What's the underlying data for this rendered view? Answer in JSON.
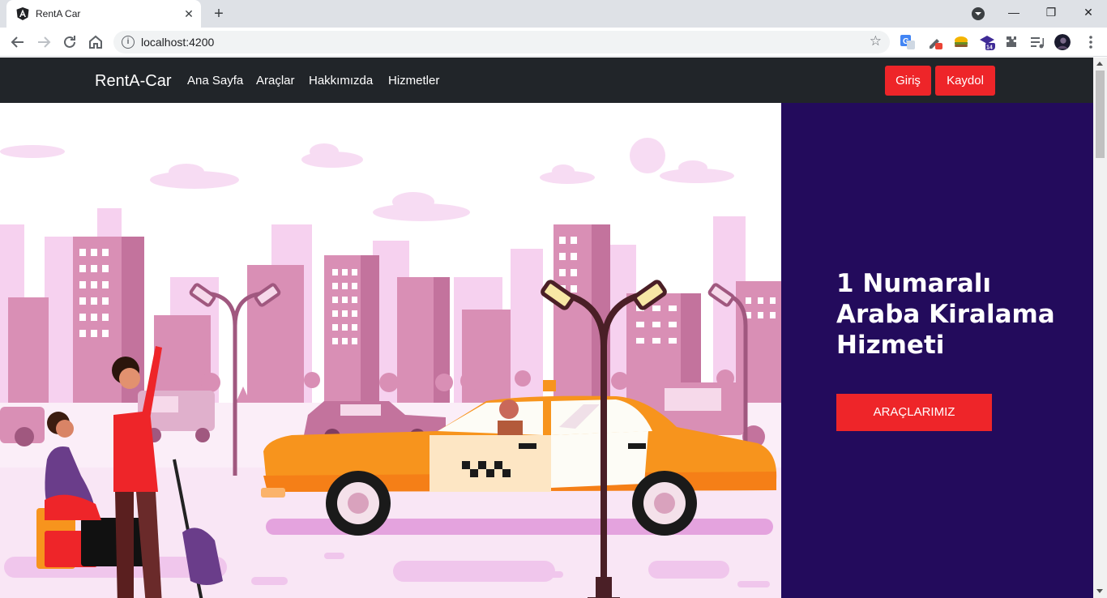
{
  "browser": {
    "tab_title": "RentA Car",
    "new_tab_label": "+",
    "tab_close_label": "✕",
    "url": "localhost:4200",
    "window_buttons": {
      "minimize": "—",
      "restore": "❐",
      "close": "✕"
    },
    "extension_badge": "14",
    "icons": [
      "back-icon",
      "forward-icon",
      "reload-icon",
      "home-icon",
      "info-icon",
      "star-icon",
      "translate-icon",
      "extensions-icon",
      "media-icon",
      "menu-icon"
    ]
  },
  "navbar": {
    "brand": "RentA-Car",
    "links": [
      "Ana Sayfa",
      "Araçlar",
      "Hakkımızda",
      "Hizmetler"
    ],
    "login_label": "Giriş",
    "signup_label": "Kaydol"
  },
  "hero": {
    "title": "1 Numaralı Araba Kiralama Hizmeti",
    "button_label": "ARAÇLARIMIZ",
    "illustration": "taxi-city-illustration"
  },
  "colors": {
    "navbar_bg": "#212529",
    "accent_red": "#ee2529",
    "panel_bg": "#230b5c",
    "taxi_orange": "#f7941d",
    "city_pink": "#e8a6c8"
  }
}
